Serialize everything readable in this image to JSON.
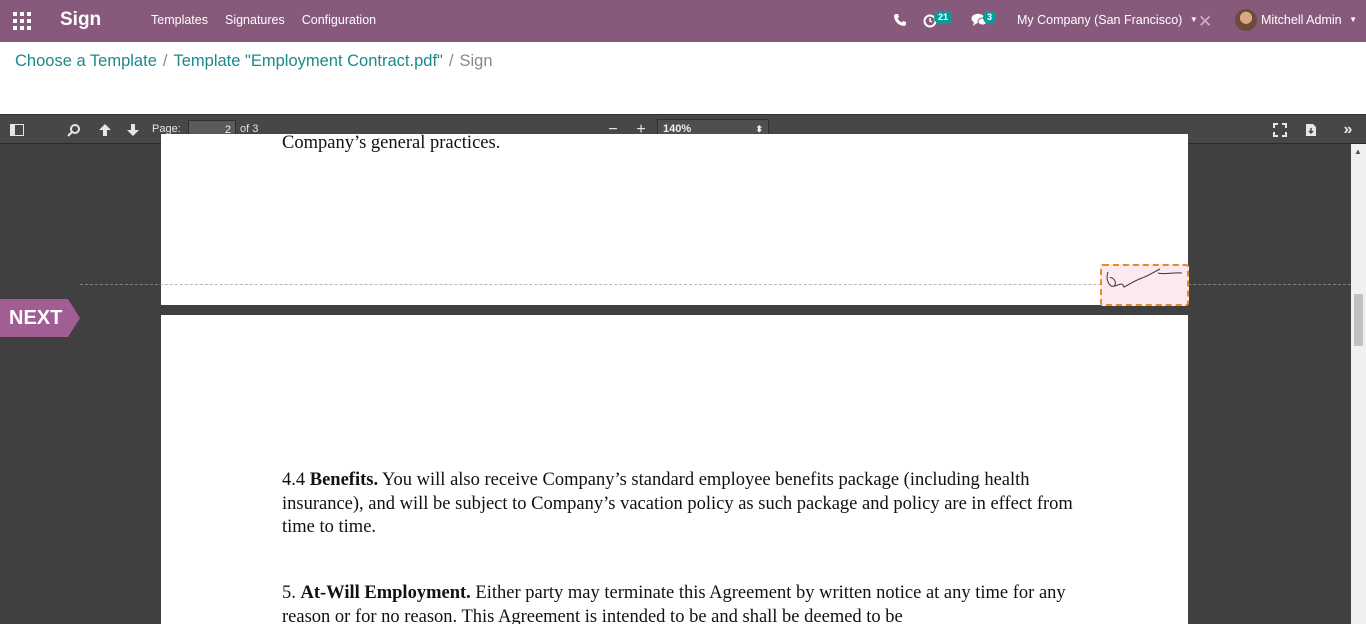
{
  "navbar": {
    "app_name": "Sign",
    "menu": [
      "Templates",
      "Signatures",
      "Configuration"
    ],
    "activity_count": "21",
    "message_count": "3",
    "company": "My Company (San Francisco)",
    "user": "Mitchell Admin",
    "brand_color": "#875a7b"
  },
  "breadcrumb": {
    "items": [
      "Choose a Template",
      "Template \"Employment Contract.pdf\""
    ],
    "active": "Sign",
    "separator": "/"
  },
  "toolbar": {
    "page_label": "Page:",
    "page_number": "2",
    "page_of": "of 3",
    "zoom": "140%",
    "zoom_out": "−",
    "zoom_in": "+"
  },
  "document": {
    "page1_fragment": "Company’s general practices.",
    "p44_number": "4.4 ",
    "p44_heading": "Benefits.",
    "p44_body": " You will also receive Company’s standard employee benefits package (including health insurance), and will be subject to Company’s vacation policy as such package and policy are in effect from time to time.",
    "p5_number": "5. ",
    "p5_heading": "At-Will Employment.",
    "p5_body": " Either party may terminate this Agreement by written notice at any time for any reason or for no reason. This Agreement is intended to be and shall be deemed to be"
  },
  "sign": {
    "next_label": "NEXT",
    "field_color": "#fbe9ef",
    "field_border": "#e28a2c"
  }
}
